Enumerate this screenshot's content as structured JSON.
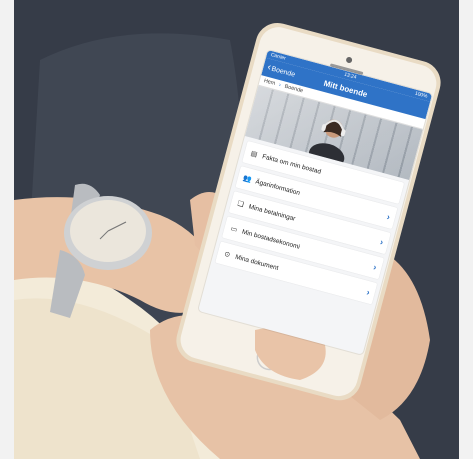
{
  "screen": {
    "status_left": "Carrier",
    "status_time": "13:24",
    "status_right": "100%",
    "back_label": "Boende",
    "title": "Mitt boende",
    "breadcrumbs": [
      "Hem",
      "Boende"
    ],
    "menu_items": [
      {
        "label": "Fakta om min bostad",
        "icon": "info-card-icon"
      },
      {
        "label": "Ägarinformation",
        "icon": "people-icon"
      },
      {
        "label": "Mina betalningar",
        "icon": "payments-icon"
      },
      {
        "label": "Min bostadsekonomi",
        "icon": "wallet-icon"
      },
      {
        "label": "Mina dokument",
        "icon": "document-icon"
      }
    ]
  },
  "colors": {
    "accent": "#2f73c7",
    "background": "#f2f2f2",
    "jeans": "#3b4250"
  }
}
